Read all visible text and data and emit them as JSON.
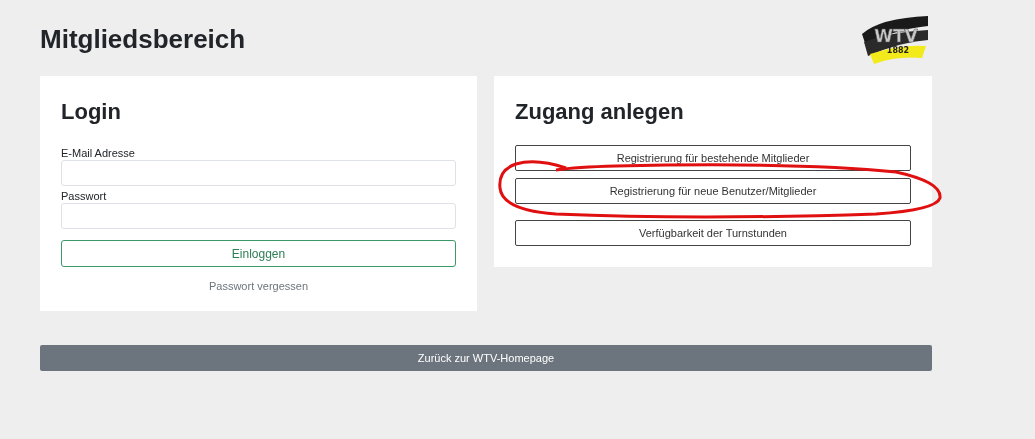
{
  "page_title": "Mitgliedsbereich",
  "logo": {
    "name": "WTV",
    "year": "1882"
  },
  "login": {
    "title": "Login",
    "fields": [
      {
        "label": "E-Mail Adresse"
      },
      {
        "label": "Passwort"
      }
    ],
    "submit": "Einloggen",
    "forgot_link": "Passwort vergessen"
  },
  "register": {
    "title": "Zugang anlegen",
    "buttons": [
      {
        "label": "Registrierung für bestehende Mitglieder",
        "highlighted": false
      },
      {
        "label": "Registrierung für neue Benutzer/Mitglieder",
        "highlighted": true
      },
      {
        "label": "Verfügbarkeit der Turnstunden",
        "highlighted": false
      }
    ]
  },
  "back_button": "Zurück zur WTV-Homepage"
}
